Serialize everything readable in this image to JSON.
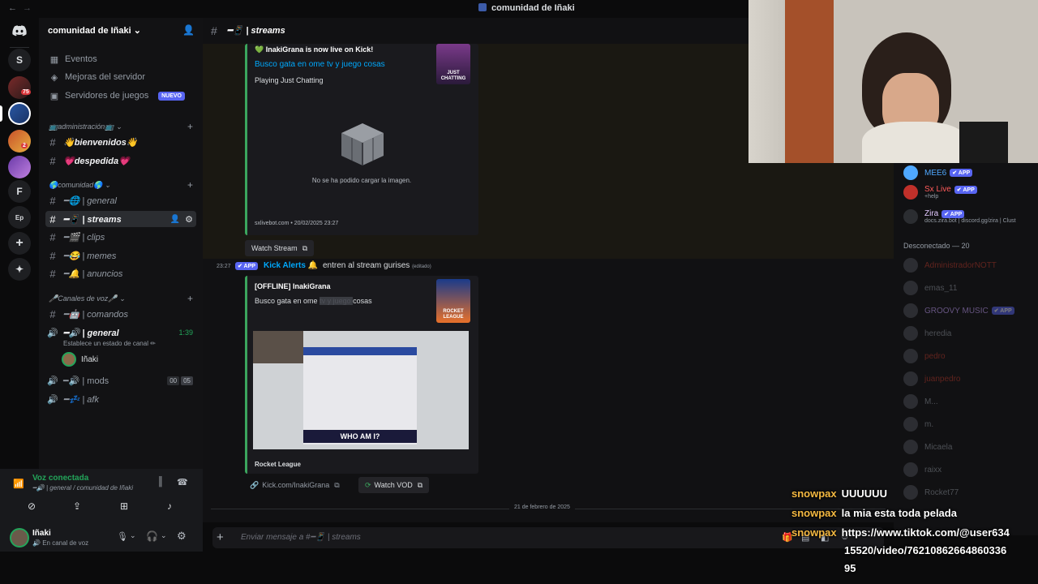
{
  "window": {
    "title": "comunidad de Iñaki",
    "back": "←",
    "forward": "→"
  },
  "server": {
    "name": "comunidad de Iñaki ⌄",
    "utility": [
      {
        "label": "Eventos"
      },
      {
        "label": "Mejoras del servidor"
      },
      {
        "label": "Servidores de juegos",
        "badge": "NUEVO"
      }
    ],
    "categories": [
      {
        "label": "📺administración📺 ⌄"
      },
      {
        "label": "🌎comunidad🌎 ⌄"
      },
      {
        "label": "🎤Canales de voz🎤 ⌄"
      }
    ],
    "channels": [
      {
        "name": "👋bienvenidos👋"
      },
      {
        "name": "💗despedida💗"
      },
      {
        "name": "━🌐 | general"
      },
      {
        "name": "━📱 | streams"
      },
      {
        "name": "━🎬 | clips"
      },
      {
        "name": "━😂 | memes"
      },
      {
        "name": "━🔔 | anuncios"
      },
      {
        "name": "━🤖 | comandos"
      }
    ],
    "voice": [
      {
        "name": "━🔊 | general",
        "time": "1:39",
        "status": "Establece un estado de canal ✏",
        "member": "Iñaki"
      },
      {
        "name": "━🔊 | mods",
        "count_a": "00",
        "count_b": "05"
      },
      {
        "name": "━💤 | afk"
      }
    ]
  },
  "rail": {
    "home_icon": "discord-icon",
    "letters": [
      "S",
      "F",
      "Ep"
    ],
    "badges": [
      "75",
      "2"
    ]
  },
  "voicebar": {
    "status": "Voz conectada",
    "location": "━🔊 | general / comunidad de Iñaki"
  },
  "user": {
    "name": "Iñaki",
    "status": "En canal de voz"
  },
  "header": {
    "channel": "━📱 | streams"
  },
  "messages": {
    "embed1": {
      "author": "InakiGrana is now live on Kick!",
      "title": "Busco gata en ome tv y juego cosas",
      "desc": "Playing Just Chatting",
      "image_error": "No se ha podido cargar la imagen.",
      "footer": "sxlivebot.com • 20/02/2025 23:27",
      "thumb": "JUST CHATTING",
      "button": "Watch Stream"
    },
    "msg2": {
      "time": "23:27",
      "app_tag": "✔ APP",
      "author": "Kick Alerts",
      "emoji": "🔔",
      "text": "entren al stream gurises",
      "edited": "(editado)"
    },
    "embed2": {
      "title": "[OFFLINE] InakiGrana",
      "desc_a": "Busco gata en ome ",
      "desc_hidden": "tv y juego ",
      "desc_b": "cosas",
      "thumb": "ROCKET LEAGUE",
      "footer": "Rocket League",
      "preview_text": "WHO AM I?"
    },
    "buttons": {
      "kick": "Kick.com/InakiGrana",
      "vod": "Watch VOD"
    },
    "date_divider": "21 de febrero de 2025"
  },
  "composer": {
    "placeholder": "Enviar mensaje a #━📱 | streams"
  },
  "members": {
    "online": [
      {
        "name": "MEE6",
        "tag": "✔ APP",
        "color": "#4fa8ff"
      },
      {
        "name": "Sx Live",
        "tag": "✔ APP",
        "sub": "+help",
        "color": "#ff5b5b"
      },
      {
        "name": "Zira",
        "tag": "✔ APP",
        "sub": "docs.zira.bot | discord.gg/zira | Clust",
        "color": "#e3c9ff"
      }
    ],
    "offline_header": "Desconectado — 20",
    "offline": [
      {
        "name": "AdministradorNOTT",
        "color": "#c0392b"
      },
      {
        "name": "emas_11",
        "color": "#949ba4"
      },
      {
        "name": "GROOVY MUSIC",
        "tag": "✔ APP",
        "color": "#c7a1ff"
      },
      {
        "name": "heredia",
        "color": "#949ba4"
      },
      {
        "name": "pedro",
        "color": "#c0392b"
      },
      {
        "name": "juanpedro",
        "color": "#c0392b"
      },
      {
        "name": "M...",
        "color": "#949ba4"
      },
      {
        "name": "m.",
        "color": "#949ba4"
      },
      {
        "name": "Micaela",
        "color": "#949ba4"
      },
      {
        "name": "raixx",
        "color": "#949ba4"
      },
      {
        "name": "Rocket77",
        "color": "#949ba4"
      }
    ]
  },
  "stream_overlay": [
    {
      "user": "snowpax",
      "msg": "UUUUUU"
    },
    {
      "user": "snowpax",
      "msg": "la mia esta toda pelada"
    },
    {
      "user": "snowpax",
      "msg": "https://www.tiktok.com/@user634"
    },
    {
      "user": "",
      "msg": "15520/video/76210862664860336"
    },
    {
      "user": "",
      "msg": "95"
    }
  ]
}
